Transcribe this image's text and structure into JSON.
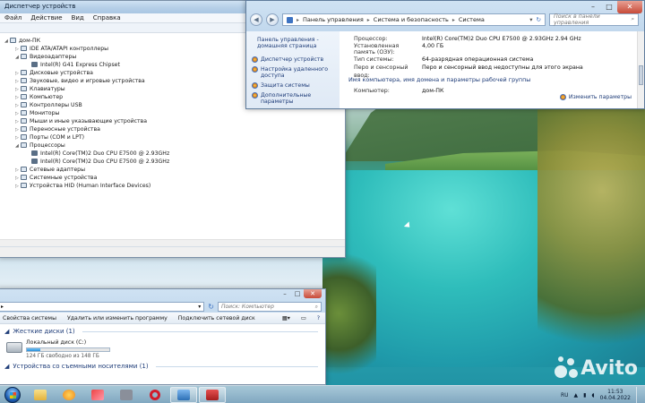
{
  "device_manager": {
    "title": "Диспетчер устройств",
    "menu": [
      "Файл",
      "Действие",
      "Вид",
      "Справка"
    ],
    "tree": [
      {
        "label": "дом-ПК",
        "level": 0,
        "expanded": true
      },
      {
        "label": "IDE ATA/ATAPI контроллеры",
        "level": 1,
        "expanded": false
      },
      {
        "label": "Видеоадаптеры",
        "level": 1,
        "expanded": true
      },
      {
        "label": "Intel(R) G41 Express Chipset",
        "level": 2
      },
      {
        "label": "Дисковые устройства",
        "level": 1,
        "expanded": false
      },
      {
        "label": "Звуковые, видео и игровые устройства",
        "level": 1,
        "expanded": false
      },
      {
        "label": "Клавиатуры",
        "level": 1,
        "expanded": false
      },
      {
        "label": "Компьютер",
        "level": 1,
        "expanded": false
      },
      {
        "label": "Контроллеры USB",
        "level": 1,
        "expanded": false
      },
      {
        "label": "Мониторы",
        "level": 1,
        "expanded": false
      },
      {
        "label": "Мыши и иные указывающие устройства",
        "level": 1,
        "expanded": false
      },
      {
        "label": "Переносные устройства",
        "level": 1,
        "expanded": false
      },
      {
        "label": "Порты (COM и LPT)",
        "level": 1,
        "expanded": false
      },
      {
        "label": "Процессоры",
        "level": 1,
        "expanded": true
      },
      {
        "label": "Intel(R) Core(TM)2 Duo CPU     E7500  @ 2.93GHz",
        "level": 2
      },
      {
        "label": "Intel(R) Core(TM)2 Duo CPU     E7500  @ 2.93GHz",
        "level": 2
      },
      {
        "label": "Сетевые адаптеры",
        "level": 1,
        "expanded": false
      },
      {
        "label": "Системные устройства",
        "level": 1,
        "expanded": false
      },
      {
        "label": "Устройства HID (Human Interface Devices)",
        "level": 1,
        "expanded": false
      }
    ]
  },
  "system_window": {
    "breadcrumb": [
      "Панель управления",
      "Система и безопасность",
      "Система"
    ],
    "search_placeholder": "Поиск в панели управления",
    "sidebar": {
      "home": "Панель управления - домашняя страница",
      "links": [
        "Диспетчер устройств",
        "Настройка удаленного доступа",
        "Защита системы",
        "Дополнительные параметры"
      ]
    },
    "props": [
      {
        "k": "Процессор:",
        "v": "Intel(R) Core(TM)2 Duo CPU     E7500  @ 2.93GHz   2.94 GHz"
      },
      {
        "k": "Установленная память (ОЗУ):",
        "v": "4,00 ГБ"
      },
      {
        "k": "Тип системы:",
        "v": "64-разрядная операционная система"
      },
      {
        "k": "Перо и сенсорный ввод:",
        "v": "Перо и сенсорный ввод недоступны для этого экрана"
      }
    ],
    "section_title": "Имя компьютера, имя домена и параметры рабочей группы",
    "computer_row": {
      "k": "Компьютер:",
      "v": "дом-ПК"
    },
    "change_link": "Изменить параметры"
  },
  "explorer": {
    "search_placeholder": "Поиск: Компьютер",
    "commands": [
      "Свойства системы",
      "Удалить или изменить программу",
      "Подключить сетевой диск"
    ],
    "group_hdd": "Жесткие диски (1)",
    "drive": {
      "name": "Локальный диск (C:)",
      "free": "124 ГБ свободно из 148 ГБ",
      "used_fraction": 0.16
    },
    "group_removable": "Устройства со съемными носителями (1)"
  },
  "taskbar": {
    "lang": "RU",
    "time": "11:53",
    "date": "04.04.2022"
  },
  "watermark": "Avito",
  "colors": {
    "accent": "#1e3c78",
    "close": "#c74a38"
  }
}
